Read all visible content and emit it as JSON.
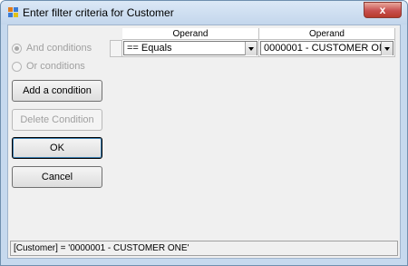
{
  "window": {
    "title": "Enter filter criteria for Customer",
    "close_label": "x"
  },
  "conditions": {
    "and_label": "And conditions",
    "or_label": "Or conditions",
    "selected": "and"
  },
  "buttons": {
    "add_condition": "Add a condition",
    "delete_condition": "Delete Condition",
    "ok": "OK",
    "cancel": "Cancel"
  },
  "grid": {
    "columns": [
      "Operand",
      "Operand"
    ],
    "rows": [
      {
        "operator": "==  Equals",
        "value": "0000001 - CUSTOMER ONE"
      }
    ]
  },
  "status": {
    "expression": "[Customer] = '0000001 - CUSTOMER ONE'"
  },
  "colors": {
    "title_bar": "#c3d6ec",
    "close_button": "#c75050",
    "dialog_background": "#f0f0f0"
  }
}
